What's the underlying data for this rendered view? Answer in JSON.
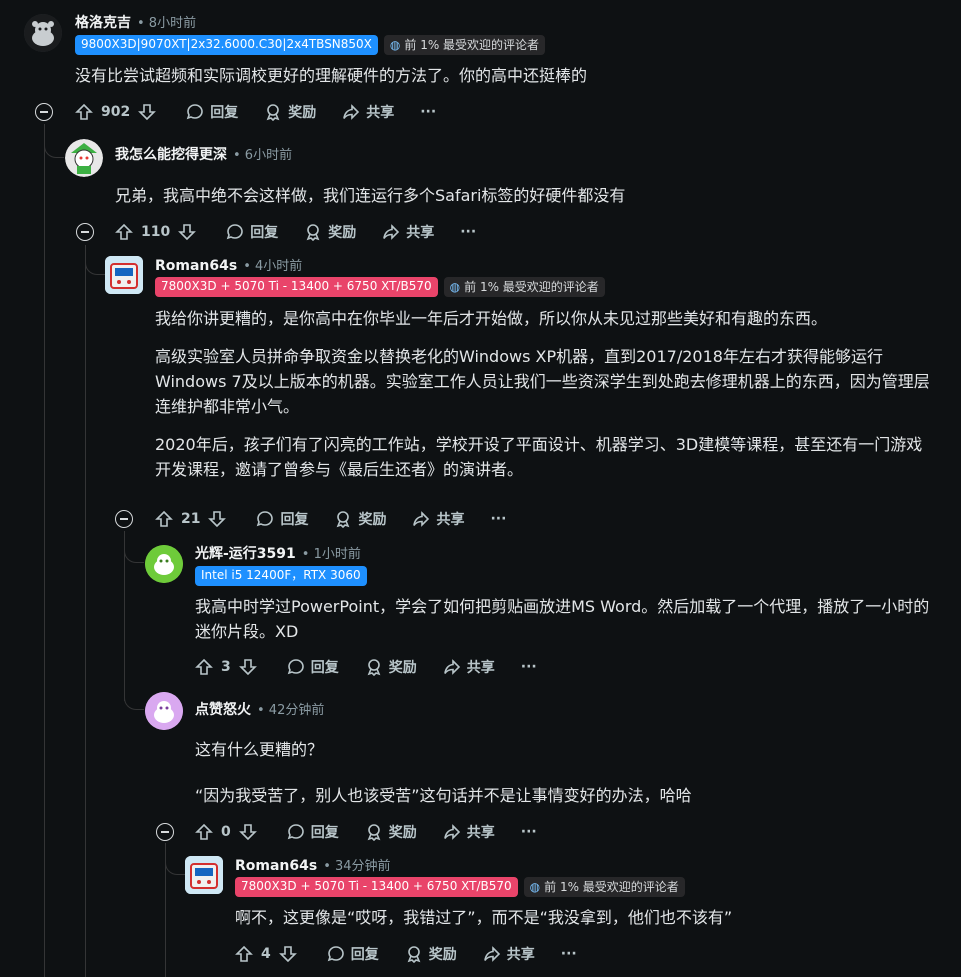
{
  "comments": [
    {
      "username": "格洛克吉",
      "time": "• 8小时前",
      "flair": "9800X3D|9070XT|2x32.6000.C30|2x4TBSN850X",
      "badge": "前 1% 最受欢迎的评论者",
      "body": [
        "没有比尝试超频和实际调校更好的理解硬件的方法了。你的高中还挺棒的"
      ],
      "votes": "902"
    },
    {
      "username": "我怎么能挖得更深",
      "time": "• 6小时前",
      "body": [
        "兄弟，我高中绝不会这样做，我们连运行多个Safari标签的好硬件都没有"
      ],
      "votes": "110"
    },
    {
      "username": "Roman64s",
      "time": "• 4小时前",
      "flair": "7800X3D + 5070 Ti - 13400 + 6750 XT/B570",
      "badge": "前 1% 最受欢迎的评论者",
      "body": [
        "我给你讲更糟的，是你高中在你毕业一年后才开始做，所以你从未见过那些美好和有趣的东西。",
        "高级实验室人员拼命争取资金以替换老化的Windows XP机器，直到2017/2018年左右才获得能够运行Windows 7及以上版本的机器。实验室工作人员让我们一些资深学生到处跑去修理机器上的东西，因为管理层连维护都非常小气。",
        "2020年后，孩子们有了闪亮的工作站，学校开设了平面设计、机器学习、3D建模等课程，甚至还有一门游戏开发课程，邀请了曾参与《最后生还者》的演讲者。"
      ],
      "votes": "21"
    },
    {
      "username": "光辉-运行3591",
      "time": "• 1小时前",
      "flair": "Intel i5 12400F，RTX 3060",
      "body": [
        "我高中时学过PowerPoint，学会了如何把剪贴画放进MS Word。然后加载了一个代理，播放了一小时的迷你片段。XD"
      ],
      "votes": "3"
    },
    {
      "username": "点赞怒火",
      "time": "• 42分钟前",
      "body": [
        "这有什么更糟的？",
        "“因为我受苦了，别人也该受苦”这句话并不是让事情变好的办法，哈哈"
      ],
      "votes": "0"
    },
    {
      "username": "Roman64s",
      "time": "• 34分钟前",
      "flair": "7800X3D + 5070 Ti - 13400 + 6750 XT/B570",
      "badge": "前 1% 最受欢迎的评论者",
      "body": [
        "啊不，这更像是“哎呀，我错过了”，而不是“我没拿到，他们也不该有”"
      ],
      "votes": "4"
    }
  ],
  "actions": {
    "reply": "回复",
    "award": "奖励",
    "share": "共享",
    "more": "···"
  },
  "colors": {
    "background": "#0e1113",
    "flair_blue": "#1e90ff",
    "flair_pink": "#e9446a",
    "badge_bg": "#272729"
  },
  "icons": [
    "upvote-icon",
    "downvote-icon",
    "comment-icon",
    "award-icon",
    "share-icon",
    "more-icon",
    "collapse-icon",
    "top-commenter-icon"
  ]
}
